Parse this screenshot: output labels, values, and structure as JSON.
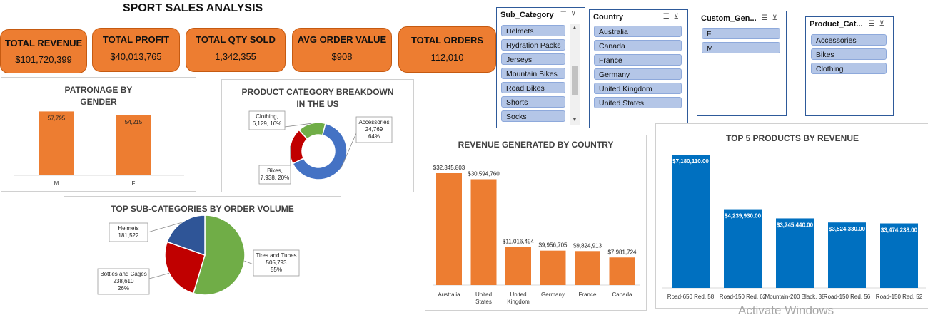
{
  "title": "SPORT SALES ANALYSIS",
  "kpis": [
    {
      "label": "TOTAL REVENUE",
      "value": "$101,720,399"
    },
    {
      "label": "TOTAL PROFIT",
      "value": "$40,013,765"
    },
    {
      "label": "TOTAL QTY SOLD",
      "value": "1,342,355"
    },
    {
      "label": "AVG ORDER VALUE",
      "value": "$908"
    },
    {
      "label": "TOTAL ORDERS",
      "value": "112,010"
    }
  ],
  "slicers": {
    "sub_category": {
      "title": "Sub_Category",
      "items": [
        "Helmets",
        "Hydration Packs",
        "Jerseys",
        "Mountain Bikes",
        "Road Bikes",
        "Shorts",
        "Socks"
      ]
    },
    "country": {
      "title": "Country",
      "items": [
        "Australia",
        "Canada",
        "France",
        "Germany",
        "United Kingdom",
        "United States"
      ]
    },
    "gender": {
      "title": "Custom_Gen...",
      "items": [
        "F",
        "M"
      ]
    },
    "product_category": {
      "title": "Product_Cat...",
      "items": [
        "Accessories",
        "Bikes",
        "Clothing"
      ]
    }
  },
  "colors": {
    "orange": "#ed7d31",
    "blue": "#4472c4",
    "dark_blue": "#0070c0",
    "green": "#70ad47",
    "red": "#c00000",
    "navy": "#2f5597",
    "slicer_item": "#b4c6e7"
  },
  "icons": {
    "multi_select": "multi-select-icon",
    "clear_filter": "clear-filter-icon"
  },
  "watermark": "Activate Windows",
  "chart_data": [
    {
      "id": "gender",
      "type": "bar",
      "title_line1": "PATRONAGE BY",
      "title_line2": "GENDER",
      "categories": [
        "M",
        "F"
      ],
      "values": [
        57795,
        54215
      ],
      "data_labels": [
        "57,795",
        "54,215"
      ],
      "grid": false
    },
    {
      "id": "category_us",
      "type": "pie",
      "subtype": "doughnut",
      "title_line1": "PRODUCT CATEGORY  BREAKDOWN",
      "title_line2": "IN THE US",
      "categories": [
        "Accessories",
        "Bikes",
        "Clothing"
      ],
      "values": [
        24769,
        7938,
        6129
      ],
      "percents": [
        64,
        20,
        16
      ],
      "labels": [
        [
          "Accessories",
          "24,769",
          "64%"
        ],
        [
          "Bikes,",
          "7,938, 20%"
        ],
        [
          "Clothing,",
          "6,129, 16%"
        ]
      ]
    },
    {
      "id": "subcat_orders",
      "type": "pie",
      "title": "TOP SUB-CATEGORIES BY ORDER VOLUME",
      "categories": [
        "Tires and Tubes",
        "Bottles and Cages",
        "Helmets"
      ],
      "values": [
        505793,
        238610,
        181522
      ],
      "labels": [
        [
          "Tires and Tubes",
          "505,793",
          "55%"
        ],
        [
          "Bottles and Cages",
          "238,610",
          "26%"
        ],
        [
          "Helmets",
          "181,522"
        ]
      ]
    },
    {
      "id": "country_revenue",
      "type": "bar",
      "title": "REVENUE GENERATED BY COUNTRY",
      "categories": [
        "Australia",
        "United States",
        "United Kingdom",
        "Germany",
        "France",
        "Canada"
      ],
      "category_lines": [
        [
          "Australia"
        ],
        [
          "United",
          "States"
        ],
        [
          "United",
          "Kingdom"
        ],
        [
          "Germany"
        ],
        [
          "France"
        ],
        [
          "Canada"
        ]
      ],
      "values": [
        32345803,
        30594760,
        11016494,
        9956705,
        9824913,
        7981724
      ],
      "data_labels": [
        "$32,345,803",
        "$30,594,760",
        "$11,016,494",
        "$9,956,705",
        "$9,824,913",
        "$7,981,724"
      ],
      "grid": false
    },
    {
      "id": "top_products",
      "type": "bar",
      "title": "TOP 5 PRODUCTS BY REVENUE",
      "categories": [
        "Road-650 Red, 58",
        "Road-150 Red, 62",
        "Mountain-200 Black, 38",
        "Road-150 Red, 56",
        "Road-150 Red, 52"
      ],
      "values": [
        7180110,
        4239930,
        3745440,
        3524330,
        3474238
      ],
      "data_labels": [
        "$7,180,110.00",
        "$4,239,930.00",
        "$3,745,440.00",
        "$3,524,330.00",
        "$3,474,238.00"
      ],
      "grid": false
    }
  ]
}
